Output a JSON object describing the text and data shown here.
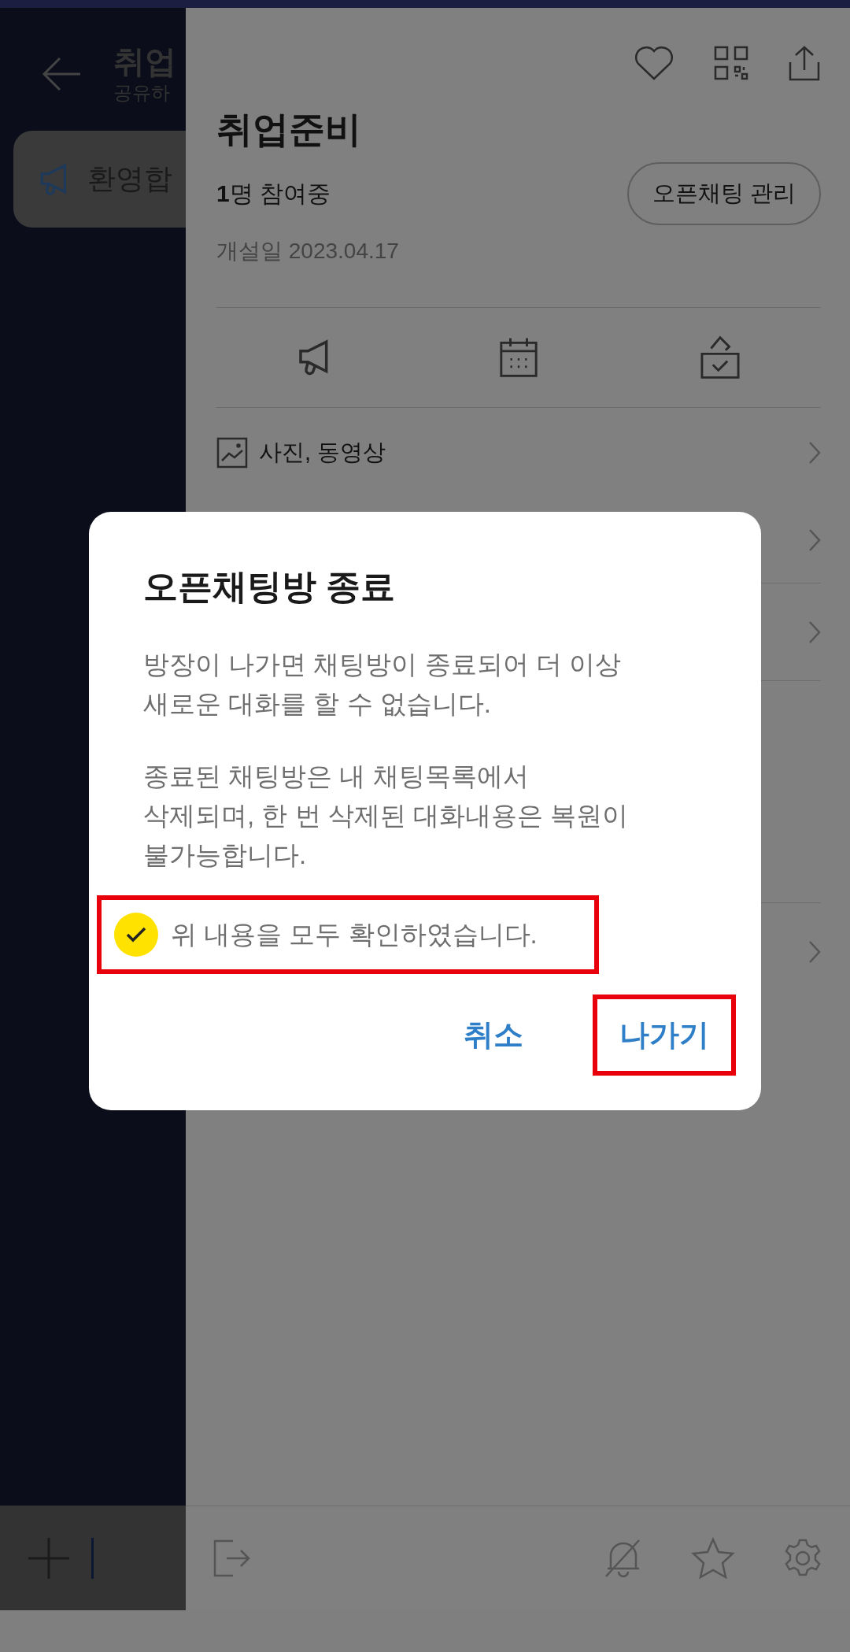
{
  "chat_behind": {
    "title": "취업",
    "subtitle": "공유하",
    "notice": "환영합"
  },
  "drawer": {
    "title": "취업준비",
    "members": "**1**명 참여중",
    "manage_button": "오픈채팅 관리",
    "created": "개설일 2023.04.17",
    "menu": [
      {
        "kind": "row",
        "label": "사진, 동영상"
      },
      {
        "kind": "row"
      },
      {
        "kind": "row"
      },
      {
        "kind": "gap"
      },
      {
        "kind": "row"
      }
    ]
  },
  "dialog": {
    "title": "오픈채팅방 종료",
    "paragraphs": [
      "방장이 나가면 채팅방이 종료되어 더 이상\n새로운 대화를 할 수 없습니다.",
      "종료된 채팅방은 내 채팅목록에서\n삭제되며, 한 번 삭제된 대화내용은 복원이\n불가능합니다."
    ],
    "checkbox": {
      "label": "위 내용을 모두 확인하였습니다.",
      "checked": true,
      "highlighted": true
    },
    "buttons": [
      {
        "label": "취소",
        "highlighted": false
      },
      {
        "label": "나가기",
        "highlighted": true
      }
    ]
  }
}
